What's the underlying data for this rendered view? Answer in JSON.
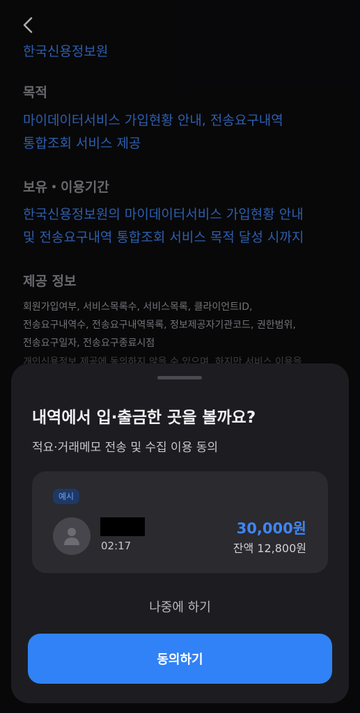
{
  "background": {
    "org_name": "한국신용정보원",
    "purpose_heading": "목적",
    "purpose_lines": [
      "마이데이터서비스 가입현황 안내, 전송요구내역",
      "통합조회 서비스 제공"
    ],
    "period_heading": "보유・이용기간",
    "period_lines": [
      "한국신용정보원의 마이데이터서비스 가입현황 안내",
      "및 전송요구내역 통합조회 서비스 목적 달성 시까지"
    ],
    "info_heading": "제공 정보",
    "info_lines": [
      "회원가입여부, 서비스목록수, 서비스목록, 클라이언트ID,",
      "전송요구내역수, 전송요구내역목록, 정보제공자기관코드, 권한범위,",
      "전송요구일자, 전송요구종료시점",
      "개인신용정보 제공에 동의하지 않을 수 있으며, 하지만 서비스 이용을"
    ]
  },
  "sheet": {
    "title": "내역에서 입·출금한 곳을 볼까요?",
    "subtitle": "적요·거래메모 전송 및 수집 이용 동의",
    "example": {
      "badge": "예시",
      "time": "02:17",
      "amount": "30,000원",
      "balance": "잔액 12,800원"
    },
    "later_label": "나중에 하기",
    "agree_label": "동의하기"
  },
  "colors": {
    "accent": "#3182f6",
    "link_blue": "#3d7ee6",
    "sheet_bg": "#1d1d21",
    "card_bg": "#2a2a2f"
  },
  "icons": [
    "back-chevron-icon",
    "user-avatar-icon"
  ]
}
